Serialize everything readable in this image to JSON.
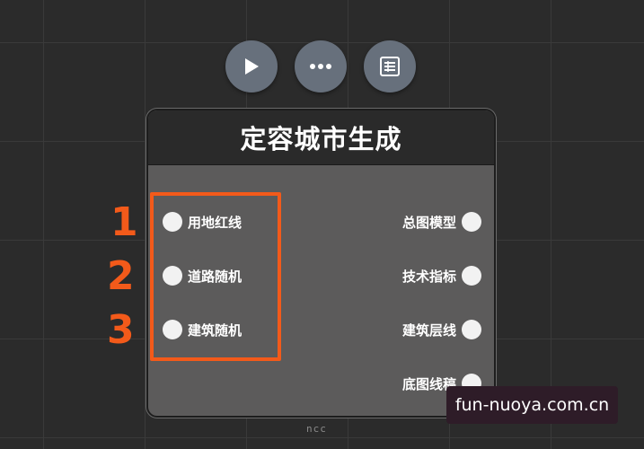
{
  "toolbar": {
    "buttons": [
      {
        "name": "play",
        "icon": "play-icon"
      },
      {
        "name": "more",
        "icon": "ellipsis-icon"
      },
      {
        "name": "panel",
        "icon": "panel-icon"
      }
    ]
  },
  "node": {
    "title": "定容城市生成",
    "inputs": [
      {
        "label": "用地红线"
      },
      {
        "label": "道路随机"
      },
      {
        "label": "建筑随机"
      }
    ],
    "outputs": [
      {
        "label": "总图模型"
      },
      {
        "label": "技术指标"
      },
      {
        "label": "建筑层线"
      },
      {
        "label": "底图线稿"
      }
    ]
  },
  "annotations": {
    "numbers": [
      "1",
      "2",
      "3"
    ],
    "highlight_color": "#f35a1a"
  },
  "watermark": {
    "text": "fun-nuoya.com.cn"
  },
  "logo_text": "ncc",
  "colors": {
    "background": "#2b2b2b",
    "node_body": "#5c5b5b",
    "node_header": "#2a2a2a",
    "button": "#67707c",
    "port": "#f2f2f2"
  }
}
